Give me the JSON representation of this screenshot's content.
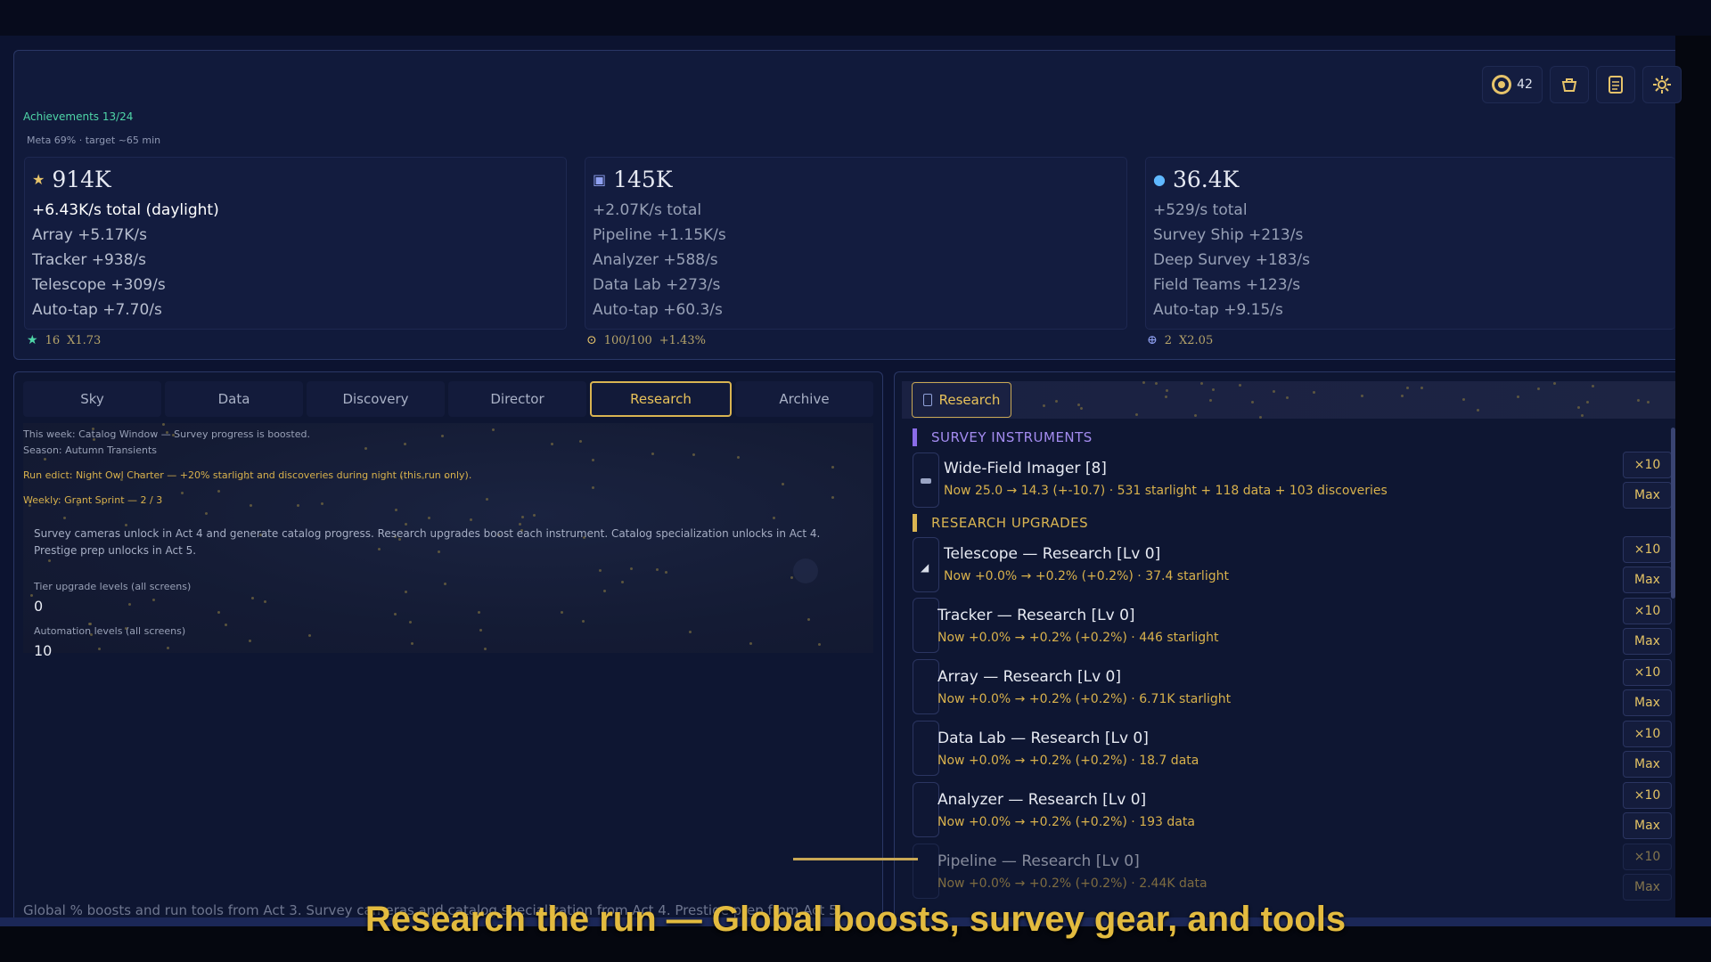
{
  "header": {
    "achievements": "Achievements 13/24",
    "meta": "Meta 69% · target ~65 min",
    "coins": "42",
    "icons": [
      "coin-icon",
      "shop-basket-icon",
      "journal-icon",
      "settings-gear-icon"
    ]
  },
  "resources": [
    {
      "icon": "star-icon",
      "amount": "914K",
      "total": "+6.43K/s total  (daylight)",
      "lines": [
        "Array  +5.17K/s",
        "Tracker  +938/s",
        "Telescope  +309/s",
        "Auto-tap  +7.70/s"
      ],
      "footer_a": "16",
      "footer_b": "X1.73"
    },
    {
      "icon": "data-chip-icon",
      "amount": "145K",
      "total": "+2.07K/s total",
      "lines": [
        "Pipeline  +1.15K/s",
        "Analyzer  +588/s",
        "Data Lab  +273/s",
        "Auto-tap  +60.3/s"
      ],
      "footer_a": "100/100",
      "footer_b": "+1.43%"
    },
    {
      "icon": "discovery-drop-icon",
      "amount": "36.4K",
      "total": "+529/s total",
      "lines": [
        "Survey Ship  +213/s",
        "Deep Survey  +183/s",
        "Field Teams  +123/s",
        "Auto-tap  +9.15/s"
      ],
      "footer_a": "2",
      "footer_b": "X2.05"
    }
  ],
  "tabs": [
    "Sky",
    "Data",
    "Discovery",
    "Director",
    "Research",
    "Archive"
  ],
  "active_tab": "Research",
  "left": {
    "week": "This week: Catalog Window — Survey progress is boosted.",
    "season": "Season: Autumn Transients",
    "edict": "Run edict: Night Owl Charter — +20% starlight and discoveries during night (this run only).",
    "weekly": "Weekly: Grant Sprint — 2 / 3",
    "description": "Survey cameras unlock in Act 4 and generate catalog progress. Research upgrades boost each instrument. Catalog specialization unlocks in Act 4. Prestige prep unlocks in Act 5.",
    "tier_label": "Tier upgrade levels (all screens)",
    "tier_value": "0",
    "automation_label": "Automation levels (all screens)",
    "automation_value": "10",
    "footer": "Global % boosts and run tools from Act 3. Survey cameras and catalog specialization from Act 4. Prestige prep from Act 5"
  },
  "right": {
    "tab_label": "Research",
    "section_instruments": "SURVEY INSTRUMENTS",
    "section_upgrades": "RESEARCH UPGRADES",
    "instrument": {
      "title": "Wide-Field Imager  [8]",
      "sub": "Now 25.0 → 14.3  (+-10.7)  ·  531 starlight + 118 data + 103 discoveries"
    },
    "upgrades": [
      {
        "title": "Telescope — Research  [Lv 0]",
        "sub": "Now +0.0% → +0.2%  (+0.2%)  ·  37.4 starlight"
      },
      {
        "title": "Tracker — Research  [Lv 0]",
        "sub": "Now +0.0% → +0.2%  (+0.2%)  ·  446 starlight"
      },
      {
        "title": "Array — Research  [Lv 0]",
        "sub": "Now +0.0% → +0.2%  (+0.2%)  ·  6.71K starlight"
      },
      {
        "title": "Data Lab — Research  [Lv 0]",
        "sub": "Now +0.0% → +0.2%  (+0.2%)  ·  18.7 data"
      },
      {
        "title": "Analyzer — Research  [Lv 0]",
        "sub": "Now +0.0% → +0.2%  (+0.2%)  ·  193 data"
      },
      {
        "title": "Pipeline — Research  [Lv 0]",
        "sub": "Now +0.0% → +0.2%  (+0.2%)  ·  2.44K data"
      }
    ],
    "btn_x10": "×10",
    "btn_max": "Max"
  },
  "caption": "Research the run — Global boosts, survey gear, and tools",
  "colors": {
    "accent_gold": "#d9b451",
    "achievement_green": "#4fd6a8",
    "section_purple": "#a48cf0",
    "panel_bg": "#111a3b"
  }
}
